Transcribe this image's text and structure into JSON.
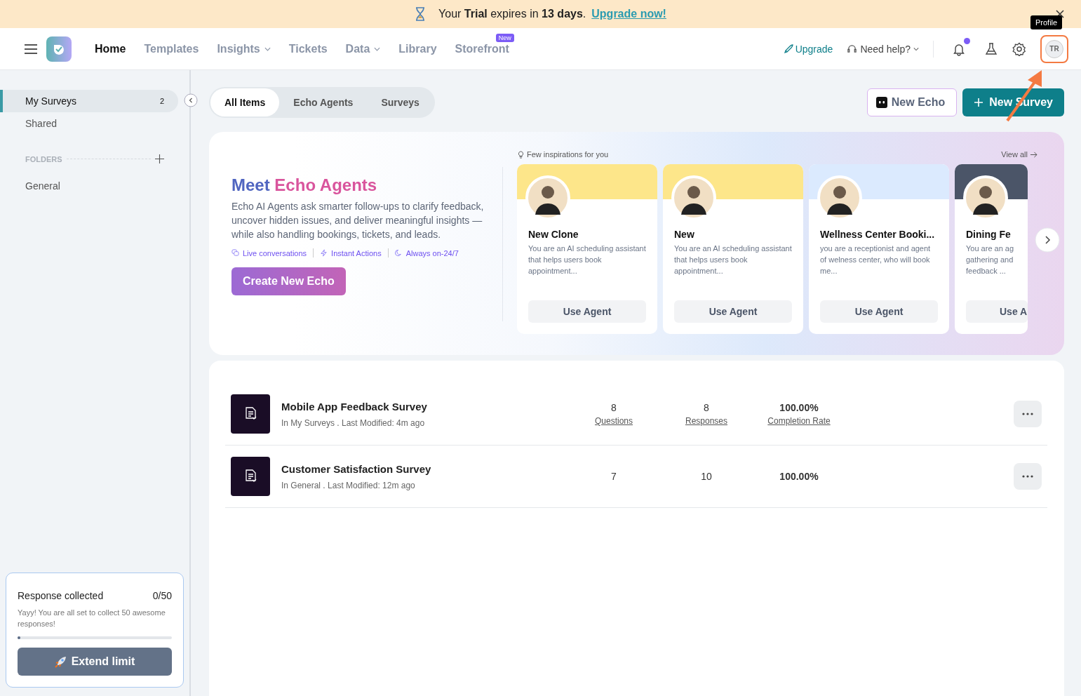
{
  "banner": {
    "text": "Your **Trial** expires in **13 days**.",
    "link": "Upgrade now!"
  },
  "nav": {
    "items": [
      {
        "label": "Home",
        "selected": true,
        "dropdown": false
      },
      {
        "label": "Templates",
        "selected": false,
        "dropdown": false
      },
      {
        "label": "Insights",
        "selected": false,
        "dropdown": true
      },
      {
        "label": "Tickets",
        "selected": false,
        "dropdown": false
      },
      {
        "label": "Data",
        "selected": false,
        "dropdown": true
      },
      {
        "label": "Library",
        "selected": false,
        "dropdown": false
      },
      {
        "label": "Storefront",
        "selected": false,
        "dropdown": false,
        "badge": "New"
      }
    ],
    "upgrade": "Upgrade",
    "help": "Need help?",
    "unread": true,
    "tooltip": "Profile",
    "avatar": "TR",
    "avatar_highlighted": true
  },
  "sidebar": {
    "items": [
      {
        "label": "My Surveys",
        "count": "2",
        "selected": true
      },
      {
        "label": "Shared",
        "selected": false
      }
    ],
    "folders_heading": "FOLDERS",
    "folders": [
      {
        "label": "General",
        "selected": false
      }
    ],
    "usage": {
      "title": "Response collected",
      "count": "0/50",
      "message": "Yayy! You are all set to collect 50 awesome responses!",
      "level": 0.02,
      "button": "Extend limit"
    }
  },
  "tabs": [
    {
      "label": "All Items",
      "selected": true
    },
    {
      "label": "Echo Agents",
      "selected": false
    },
    {
      "label": "Surveys",
      "selected": false
    }
  ],
  "actions": {
    "new_echo": "New Echo",
    "new_survey": "New Survey"
  },
  "promo": {
    "title_start": "Meet",
    "title_end": "Echo Agents",
    "description": "Echo AI Agents ask smarter follow-ups to clarify feedback, uncover hidden issues, and deliver meaningful insights — while also handling bookings, tickets, and leads.",
    "features": [
      {
        "kind": "chat",
        "label": "Live conversations"
      },
      {
        "kind": "bolt",
        "label": "Instant Actions"
      },
      {
        "kind": "clock",
        "label": "Always on-24/7"
      }
    ],
    "button": "Create New Echo"
  },
  "inspirations": {
    "heading": "Few inspirations for you",
    "view_all": "View all",
    "agents": [
      {
        "name": "New Clone",
        "description": "You are an AI scheduling assistant that helps users book appointment...",
        "button": "Use Agent",
        "color": "#fde68a"
      },
      {
        "name": "New",
        "description": "You are an AI scheduling assistant that helps users book appointment...",
        "button": "Use Agent",
        "color": "#fde68a"
      },
      {
        "name": "Wellness Center Booki...",
        "description": "you are a receptionist and agent of welness center, who will book me...",
        "button": "Use Agent",
        "color": "#dbeafe"
      },
      {
        "name": "Dining Fe",
        "description": "You are an ag\ngathering and\nfeedback ...",
        "button": "Use A",
        "color": "#4b5568"
      }
    ]
  },
  "surveys": [
    {
      "name": "Mobile App Feedback Survey",
      "meta": "In My Surveys . Last Modified: 4m ago",
      "questions": "8",
      "questions_label": "Questions",
      "responses": "8",
      "responses_label": "Responses",
      "completion": "100.00%",
      "completion_label": "Completion Rate"
    },
    {
      "name": "Customer Satisfaction Survey",
      "meta": "In General . Last Modified: 12m ago",
      "questions": "7",
      "responses": "10",
      "completion": "100.00%"
    }
  ]
}
